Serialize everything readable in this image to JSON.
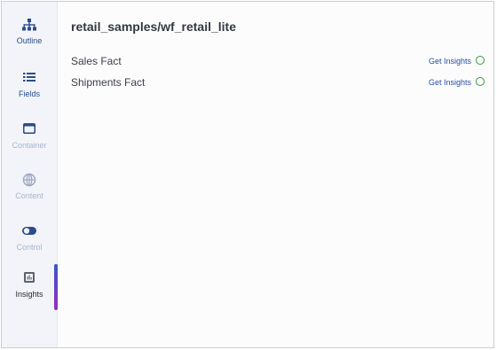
{
  "sidebar": {
    "items": [
      {
        "label": "Outline",
        "icon": "hierarchy-icon",
        "state": "enabled"
      },
      {
        "label": "Fields",
        "icon": "list-icon",
        "state": "enabled"
      },
      {
        "label": "Container",
        "icon": "container-icon",
        "state": "disabled"
      },
      {
        "label": "Content",
        "icon": "globe-icon",
        "state": "disabled"
      },
      {
        "label": "Control",
        "icon": "toggle-icon",
        "state": "disabled"
      },
      {
        "label": "Insights",
        "icon": "insights-icon",
        "state": "active"
      }
    ]
  },
  "main": {
    "title": "retail_samples/wf_retail_lite",
    "rows": [
      {
        "name": "Sales Fact",
        "action": "Get Insights",
        "status": "status-circle-icon"
      },
      {
        "name": "Shipments Fact",
        "action": "Get Insights",
        "status": "status-circle-icon"
      }
    ]
  },
  "colors": {
    "accent": "#2a4c8c",
    "disabled": "#a8b5cd",
    "link": "#2a4fa3",
    "status": "#2f9a3c",
    "active_gradient_start": "#3c56c8",
    "active_gradient_end": "#9a2fbc"
  }
}
